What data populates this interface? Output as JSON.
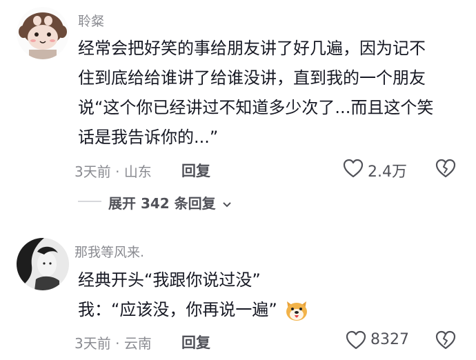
{
  "comments": [
    {
      "username": "聆粲",
      "lines": [
        "经常会把好笑的事给朋友讲了好几遍，因为记不",
        "住到底给给谁讲了给谁没讲，直到我的一个朋友",
        "说“这个你已经讲过不知道多少次了...而且这个笑",
        "话是我告诉你的...”"
      ],
      "time": "3天前",
      "location": "山东",
      "reply_label": "回复",
      "likes": "2.4万",
      "expand_replies": "展开 342 条回复"
    },
    {
      "username": "那我等风来.",
      "lines": [
        "经典开头“我跟你说过没”",
        "我：“应该没，你再说一遍”"
      ],
      "time": "3天前",
      "location": "云南",
      "reply_label": "回复",
      "likes": "8327"
    }
  ],
  "icons": {
    "like": "heart-outline-icon",
    "dislike": "broken-heart-icon",
    "expand": "chevron-down-icon",
    "emoji": "dog-face-emoji"
  },
  "colors": {
    "text": "#161823",
    "muted": "#8a8b91",
    "secondary": "#505158"
  }
}
